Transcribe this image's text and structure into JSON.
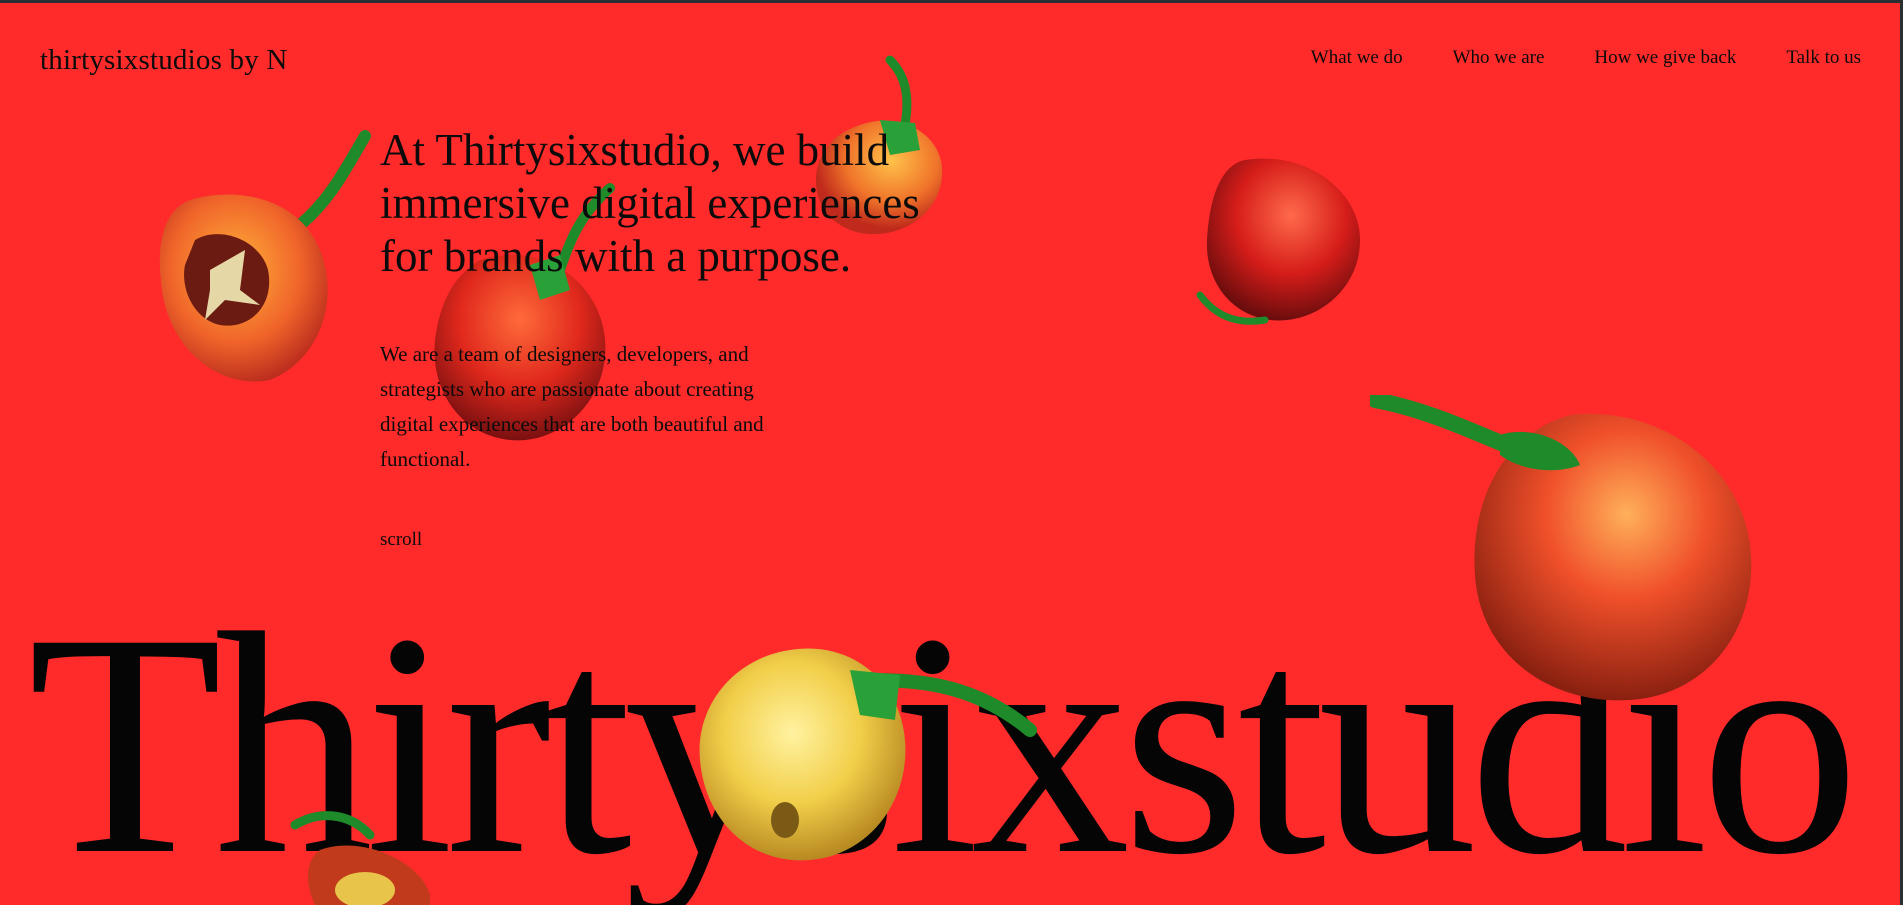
{
  "brand": {
    "name": "thirtysixstudios by N"
  },
  "nav": {
    "items": [
      {
        "label": "What we do"
      },
      {
        "label": "Who we are"
      },
      {
        "label": "How we give back"
      },
      {
        "label": "Talk to us"
      }
    ]
  },
  "hero": {
    "title": "At Thirtysixstudio, we build immersive digital experiences for brands with a purpose.",
    "body": "We are a team of designers, developers, and strategists who are passionate about creating digital experiences that are both beautiful and functional.",
    "scroll_label": "scroll"
  },
  "wordmark": {
    "text": "Thirtysixstudio"
  },
  "theme": {
    "background": "#ff2b2b",
    "text": "#0b0b0b",
    "frame": "#2b2f33"
  },
  "decor": {
    "icons": [
      "habanero-pepper-orange-cut",
      "habanero-pepper-red",
      "habanero-pepper-orange-small",
      "habanero-pepper-red-right",
      "habanero-pepper-orange-large",
      "habanero-pepper-yellow",
      "habanero-pepper-yellow-bottom"
    ]
  }
}
